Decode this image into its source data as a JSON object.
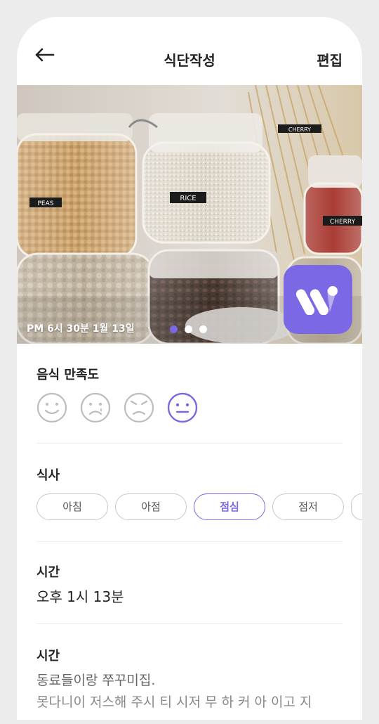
{
  "header": {
    "title": "식단작성",
    "edit_label": "편집"
  },
  "photo": {
    "timestamp": "PM 6시 30분 1월 13일",
    "jar_labels": [
      "PEAS",
      "RICE",
      "CHERRY",
      "CHERRY"
    ],
    "page_count": 3,
    "active_page": 1
  },
  "satisfaction": {
    "label": "음식 만족도",
    "options": [
      "smiling-face",
      "crying-face",
      "angry-face",
      "neutral-face"
    ],
    "selected": "neutral-face"
  },
  "meal": {
    "label": "식사",
    "options": [
      "아침",
      "아점",
      "점심",
      "점저",
      ""
    ],
    "selected": "점심"
  },
  "time": {
    "label": "시간",
    "value": "오후 1시 13분"
  },
  "memo": {
    "label": "시간",
    "line1": "동료들이랑 쭈꾸미집.",
    "line2": "못다니이 저스해 주시 티 시저 무 하 커 아 이고 지"
  },
  "colors": {
    "accent": "#7b68e4",
    "chip_border": "#c8c8c8",
    "divider": "#ececec",
    "frame": "#ececec"
  }
}
